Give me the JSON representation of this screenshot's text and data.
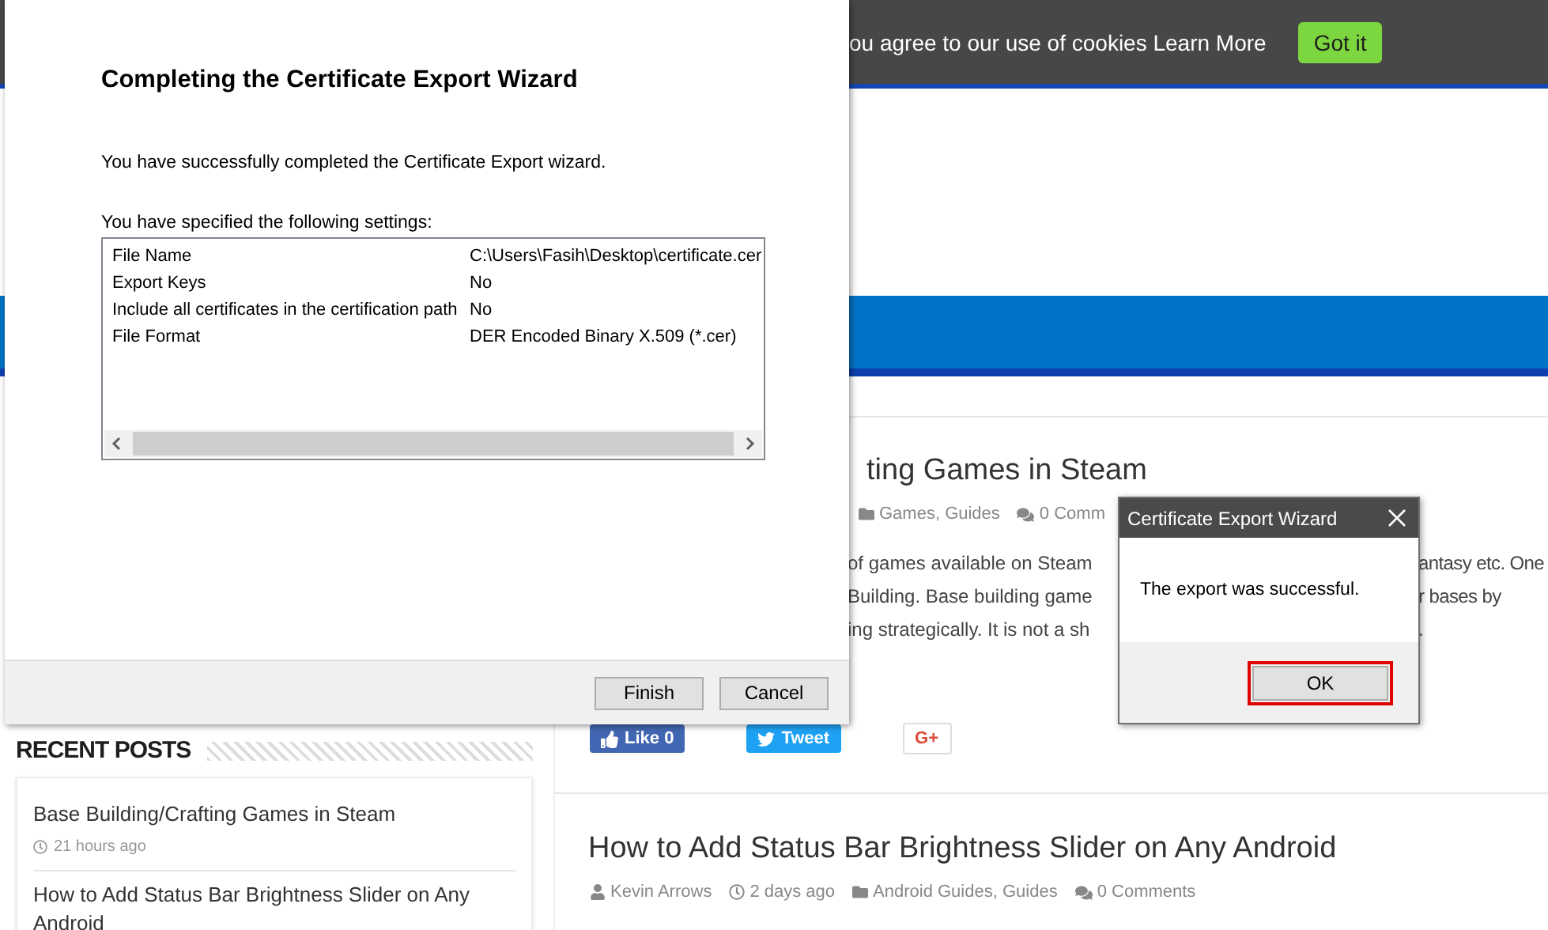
{
  "cookie_bar": {
    "text": "ou agree to our use of cookies Learn More",
    "button": "Got it"
  },
  "recent_posts": {
    "heading": "RECENT POSTS",
    "items": [
      {
        "title": "Base Building/Crafting Games in Steam",
        "time": "21 hours ago"
      },
      {
        "title": "How to Add Status Bar Brightness Slider on Any Android"
      }
    ]
  },
  "articles": [
    {
      "title": "ting Games in Steam",
      "meta": [
        {
          "kind": "category",
          "text": "Games, Guides"
        },
        {
          "kind": "comments",
          "text": "0 Comm"
        }
      ],
      "excerpt": [
        {
          "left": "of games available on Steam",
          "right": "antasy etc. One"
        },
        {
          "left": "Building. Base building game",
          "right": "r bases by"
        },
        {
          "left": "ing strategically. It is not a sh",
          "right": "."
        }
      ],
      "share": [
        {
          "kind": "like",
          "label": "Like 0"
        },
        {
          "kind": "tweet",
          "label": "Tweet"
        },
        {
          "kind": "gplus",
          "label": "G+"
        }
      ]
    },
    {
      "title": "How to Add Status Bar Brightness Slider on Any Android",
      "meta": [
        {
          "kind": "author",
          "text": "Kevin Arrows"
        },
        {
          "kind": "date",
          "text": "2 days ago"
        },
        {
          "kind": "category",
          "text": "Android Guides, Guides"
        },
        {
          "kind": "comments",
          "text": "0 Comments"
        }
      ]
    }
  ],
  "wizard": {
    "heading": "Completing the Certificate Export Wizard",
    "message": "You have successfully completed the Certificate Export wizard.",
    "settings_label": "You have specified the following settings:",
    "settings": [
      {
        "name": "File Name",
        "value": "C:\\Users\\Fasih\\Desktop\\certificate.cer"
      },
      {
        "name": "Export Keys",
        "value": "No"
      },
      {
        "name": "Include all certificates in the certification path",
        "value": "No"
      },
      {
        "name": "File Format",
        "value": "DER Encoded Binary X.509 (*.cer)"
      }
    ],
    "buttons": [
      "Finish",
      "Cancel"
    ]
  },
  "message_box": {
    "title": "Certificate Export Wizard",
    "message": "The export was successful.",
    "button": "OK",
    "button_highlighted": true
  }
}
